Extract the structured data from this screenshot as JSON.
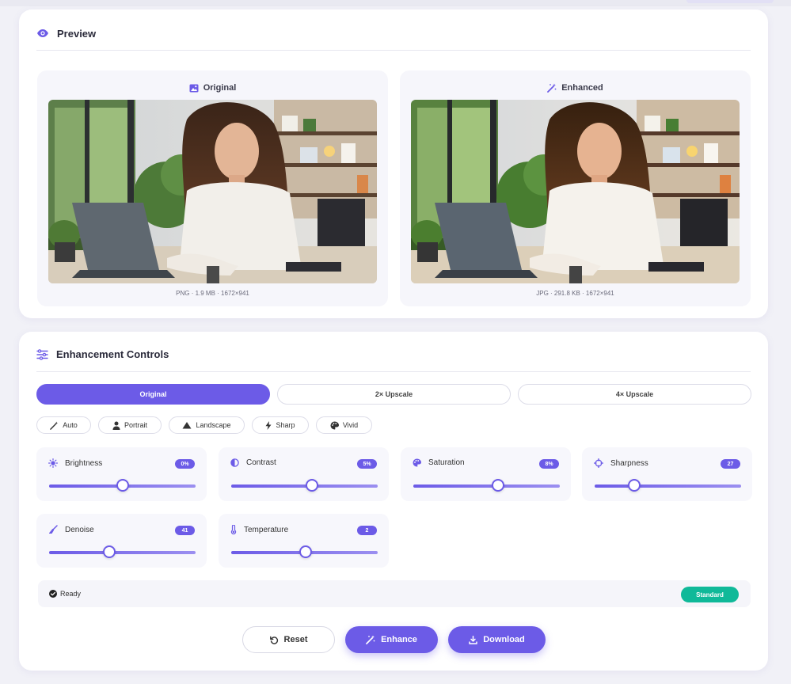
{
  "preview": {
    "title": "Preview",
    "original": {
      "label": "Original",
      "meta": "PNG · 1.9 MB · 1672×941"
    },
    "enhanced": {
      "label": "Enhanced",
      "meta": "JPG · 291.8 KB · 1672×941"
    }
  },
  "controls": {
    "title": "Enhancement Controls",
    "tabs": [
      {
        "label": "Original",
        "active": true
      },
      {
        "label": "2× Upscale",
        "active": false
      },
      {
        "label": "4× Upscale",
        "active": false
      }
    ],
    "presets": [
      {
        "label": "Auto",
        "icon": "magic-wand-icon"
      },
      {
        "label": "Portrait",
        "icon": "person-icon"
      },
      {
        "label": "Landscape",
        "icon": "mountain-icon"
      },
      {
        "label": "Sharp",
        "icon": "bolt-icon"
      },
      {
        "label": "Vivid",
        "icon": "palette-icon"
      }
    ],
    "sliders": [
      {
        "label": "Brightness",
        "value": "0%",
        "icon": "sun-icon",
        "level": 0.5
      },
      {
        "label": "Contrast",
        "value": "5%",
        "icon": "contrast-icon",
        "level": 0.55
      },
      {
        "label": "Saturation",
        "value": "8%",
        "icon": "palette-icon",
        "level": 0.58
      },
      {
        "label": "Sharpness",
        "value": "27",
        "icon": "crosshair-icon",
        "level": 0.27
      },
      {
        "label": "Denoise",
        "value": "41",
        "icon": "broom-icon",
        "level": 0.41
      },
      {
        "label": "Temperature",
        "value": "2",
        "icon": "thermometer-icon",
        "level": 0.51
      }
    ],
    "status": {
      "text": "Ready",
      "mode": "Standard"
    },
    "buttons": {
      "reset": "Reset",
      "enhance": "Enhance",
      "download": "Download"
    }
  },
  "colors": {
    "accent": "#6c5be7",
    "success": "#10b999"
  }
}
